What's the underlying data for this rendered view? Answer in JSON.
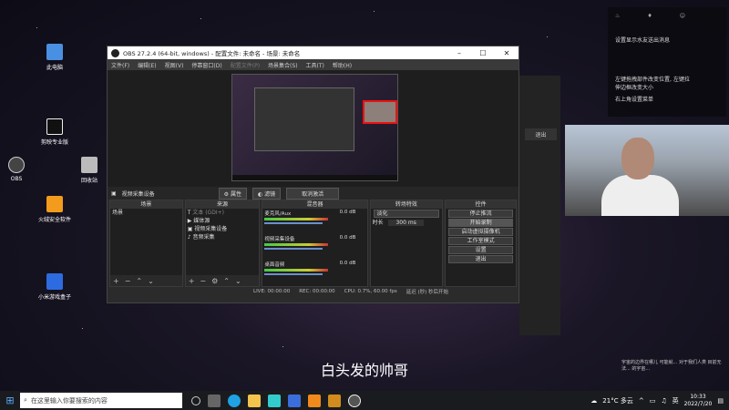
{
  "desktop_icons": [
    {
      "label": "此电脑",
      "color": "#4a90e2"
    },
    {
      "label": "剪映专业版",
      "color": "#111111"
    },
    {
      "label": "OBS",
      "color": "#444444"
    },
    {
      "label": "回收站",
      "color": "#bbbbbb"
    },
    {
      "label": "火绒安全软件",
      "color": "#f39b1c"
    },
    {
      "label": "小米游戏盒子",
      "color": "#2d6be0"
    }
  ],
  "obs": {
    "title": "OBS 27.2.4 (64-bit, windows) - 配置文件: 未命名 - 场景: 未命名",
    "menu": [
      "文件(F)",
      "编辑(E)",
      "视图(V)",
      "停靠窗口(D)",
      "配置文件(P)",
      "场景集合(S)",
      "工具(T)",
      "帮助(H)"
    ],
    "source_bar": {
      "source": "视频采集设备",
      "properties": "属性",
      "filters": "滤镜",
      "deactivate": "取消激活"
    },
    "scenes": {
      "title": "场景",
      "items": [
        "场景"
      ]
    },
    "sources": {
      "title": "来源",
      "items": [
        "文本 (GDI+)",
        "媒体源",
        "视频采集设备",
        "音频采集"
      ]
    },
    "mixer": {
      "title": "混音器",
      "channels": [
        {
          "name": "麦克风/Aux",
          "db": "0.0 dB"
        },
        {
          "name": "视频采集设备",
          "db": "0.0 dB"
        },
        {
          "name": "桌面音频",
          "db": "0.0 dB"
        }
      ]
    },
    "transitions": {
      "title": "转场特效",
      "type": "淡化",
      "duration_label": "时长",
      "duration": "300 ms"
    },
    "controls": {
      "title": "控件",
      "buttons": [
        "停止推流",
        "开始录制",
        "启动虚拟摄像机",
        "工作室模式",
        "设置",
        "退出"
      ]
    },
    "status": {
      "live": "LIVE: 00:00:00",
      "rec": "REC: 00:00:00",
      "cpu": "CPU: 0.7%, 60.00 fps",
      "delay": "延迟 (秒) 秒后开始"
    }
  },
  "bg_app": {
    "exit": "退出"
  },
  "notif": {
    "line1": "设置显示水友送出消息",
    "line2": "左键拖拽部件改变位置, 左键拉伸边框改变大小",
    "line3": "右上角设置菜单"
  },
  "subtitle": "白头发的帅哥",
  "corner_text": "宇宙的边界在哪儿 可能就... 对于我们人类 目前无法... 的宇宙...",
  "taskbar": {
    "search_placeholder": "在这里输入你要搜索的内容",
    "weather": "21°C 多云",
    "lang": "英",
    "time": "10:33",
    "date": "2022/7/20"
  }
}
